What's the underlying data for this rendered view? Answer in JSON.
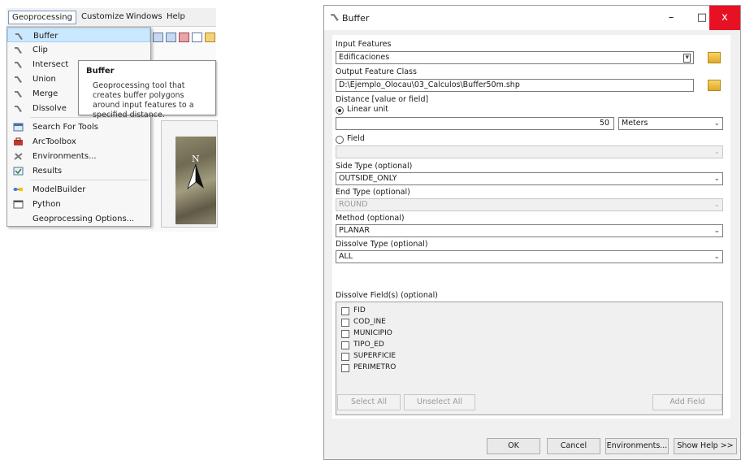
{
  "arcmap": {
    "menubar": [
      "Geoprocessing",
      "Customize",
      "Windows",
      "Help"
    ],
    "menu_items": [
      {
        "label": "Buffer",
        "icon": "hammer-icon",
        "highlighted": true
      },
      {
        "label": "Clip",
        "icon": "hammer-icon"
      },
      {
        "label": "Intersect",
        "icon": "hammer-icon"
      },
      {
        "label": "Union",
        "icon": "hammer-icon"
      },
      {
        "label": "Merge",
        "icon": "hammer-icon"
      },
      {
        "label": "Dissolve",
        "icon": "hammer-icon"
      },
      {
        "label": "Search For Tools",
        "icon": "search-window-icon"
      },
      {
        "label": "ArcToolbox",
        "icon": "toolbox-icon"
      },
      {
        "label": "Environments...",
        "icon": "environments-icon"
      },
      {
        "label": "Results",
        "icon": "results-icon"
      },
      {
        "label": "ModelBuilder",
        "icon": "modelbuilder-icon"
      },
      {
        "label": "Python",
        "icon": "python-window-icon"
      },
      {
        "label": "Geoprocessing Options...",
        "icon": ""
      }
    ],
    "tooltip": {
      "title": "Buffer",
      "body": "Geoprocessing tool that creates buffer polygons around input features to a specified distance."
    },
    "north_arrow": "N"
  },
  "dialog": {
    "title": "Buffer",
    "window_buttons": {
      "minimize": "–",
      "maximize": "□",
      "close": "x"
    },
    "input_features": {
      "label": "Input Features",
      "value": "Edificaciones"
    },
    "output_feature_class": {
      "label": "Output Feature Class",
      "value": "D:\\Ejemplo_Olocau\\03_Calculos\\Buffer50m.shp"
    },
    "distance": {
      "label": "Distance [value or field]",
      "linear_unit_label": "Linear unit",
      "value": "50",
      "unit": "Meters",
      "field_label": "Field",
      "selected": "Linear unit"
    },
    "side_type": {
      "label": "Side Type (optional)",
      "value": "OUTSIDE_ONLY"
    },
    "end_type": {
      "label": "End Type (optional)",
      "value": "ROUND"
    },
    "method": {
      "label": "Method (optional)",
      "value": "PLANAR"
    },
    "dissolve_type": {
      "label": "Dissolve Type (optional)",
      "value": "ALL"
    },
    "dissolve_fields": {
      "label": "Dissolve Field(s) (optional)",
      "fields": [
        "FID",
        "COD_INE",
        "MUNICIPIO",
        "TIPO_ED",
        "SUPERFICIE",
        "PERIMETRO"
      ]
    },
    "list_buttons": {
      "select_all": "Select All",
      "unselect_all": "Unselect All",
      "add_field": "Add Field"
    },
    "footer_buttons": {
      "ok": "OK",
      "cancel": "Cancel",
      "environments": "Environments...",
      "show_help": "Show Help >>"
    }
  }
}
